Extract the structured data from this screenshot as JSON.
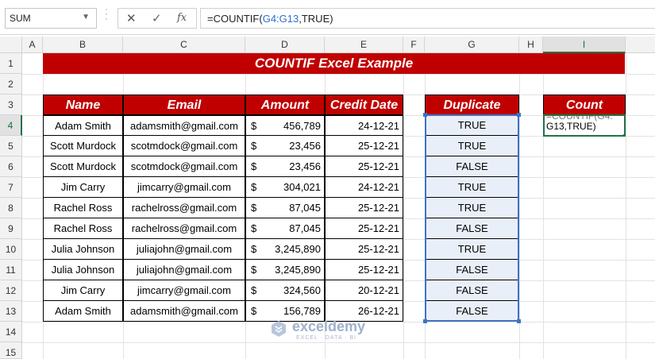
{
  "formula_bar": {
    "name_box": "SUM",
    "cancel_icon": "✕",
    "enter_icon": "✓",
    "fx_icon": "fx",
    "formula_prefix": "=COUNTIF(",
    "formula_ref": "G4:G13",
    "formula_suffix": ",TRUE)"
  },
  "columns": [
    "A",
    "B",
    "C",
    "D",
    "E",
    "F",
    "G",
    "H",
    "I"
  ],
  "rows": [
    "1",
    "2",
    "3",
    "4",
    "5",
    "6",
    "7",
    "8",
    "9",
    "10",
    "11",
    "12",
    "13",
    "14",
    "15"
  ],
  "title": "COUNTIF Excel Example",
  "table": {
    "headers": [
      "Name",
      "Email",
      "Amount",
      "Credit Date"
    ],
    "currency_symbol": "$",
    "rows": [
      {
        "name": "Adam Smith",
        "email": "adamsmith@gmail.com",
        "amount": "456,789",
        "date": "24-12-21"
      },
      {
        "name": "Scott Murdock",
        "email": "scotmdock@gmail.com",
        "amount": "23,456",
        "date": "25-12-21"
      },
      {
        "name": "Scott Murdock",
        "email": "scotmdock@gmail.com",
        "amount": "23,456",
        "date": "25-12-21"
      },
      {
        "name": "Jim Carry",
        "email": "jimcarry@gmail.com",
        "amount": "304,021",
        "date": "24-12-21"
      },
      {
        "name": "Rachel Ross",
        "email": "rachelross@gmail.com",
        "amount": "87,045",
        "date": "25-12-21"
      },
      {
        "name": "Rachel Ross",
        "email": "rachelross@gmail.com",
        "amount": "87,045",
        "date": "25-12-21"
      },
      {
        "name": "Julia Johnson",
        "email": "juliajohn@gmail.com",
        "amount": "3,245,890",
        "date": "25-12-21"
      },
      {
        "name": "Julia Johnson",
        "email": "juliajohn@gmail.com",
        "amount": "3,245,890",
        "date": "25-12-21"
      },
      {
        "name": "Jim Carry",
        "email": "jimcarry@gmail.com",
        "amount": "324,560",
        "date": "20-12-21"
      },
      {
        "name": "Adam Smith",
        "email": "adamsmith@gmail.com",
        "amount": "156,789",
        "date": "26-12-21"
      }
    ]
  },
  "duplicate": {
    "header": "Duplicate",
    "values": [
      "TRUE",
      "TRUE",
      "FALSE",
      "TRUE",
      "TRUE",
      "FALSE",
      "TRUE",
      "FALSE",
      "FALSE",
      "FALSE"
    ]
  },
  "count": {
    "header": "Count",
    "edit_line1": "=COUNTIF(G4:",
    "edit_line2": "G13,TRUE)"
  },
  "watermark": {
    "name": "exceldemy",
    "tagline": "EXCEL · DATA · BI"
  },
  "colors": {
    "header_red": "#c00000",
    "selection_blue": "#3f72c4",
    "excel_green": "#217346",
    "dup_fill": "#e9eff9"
  }
}
